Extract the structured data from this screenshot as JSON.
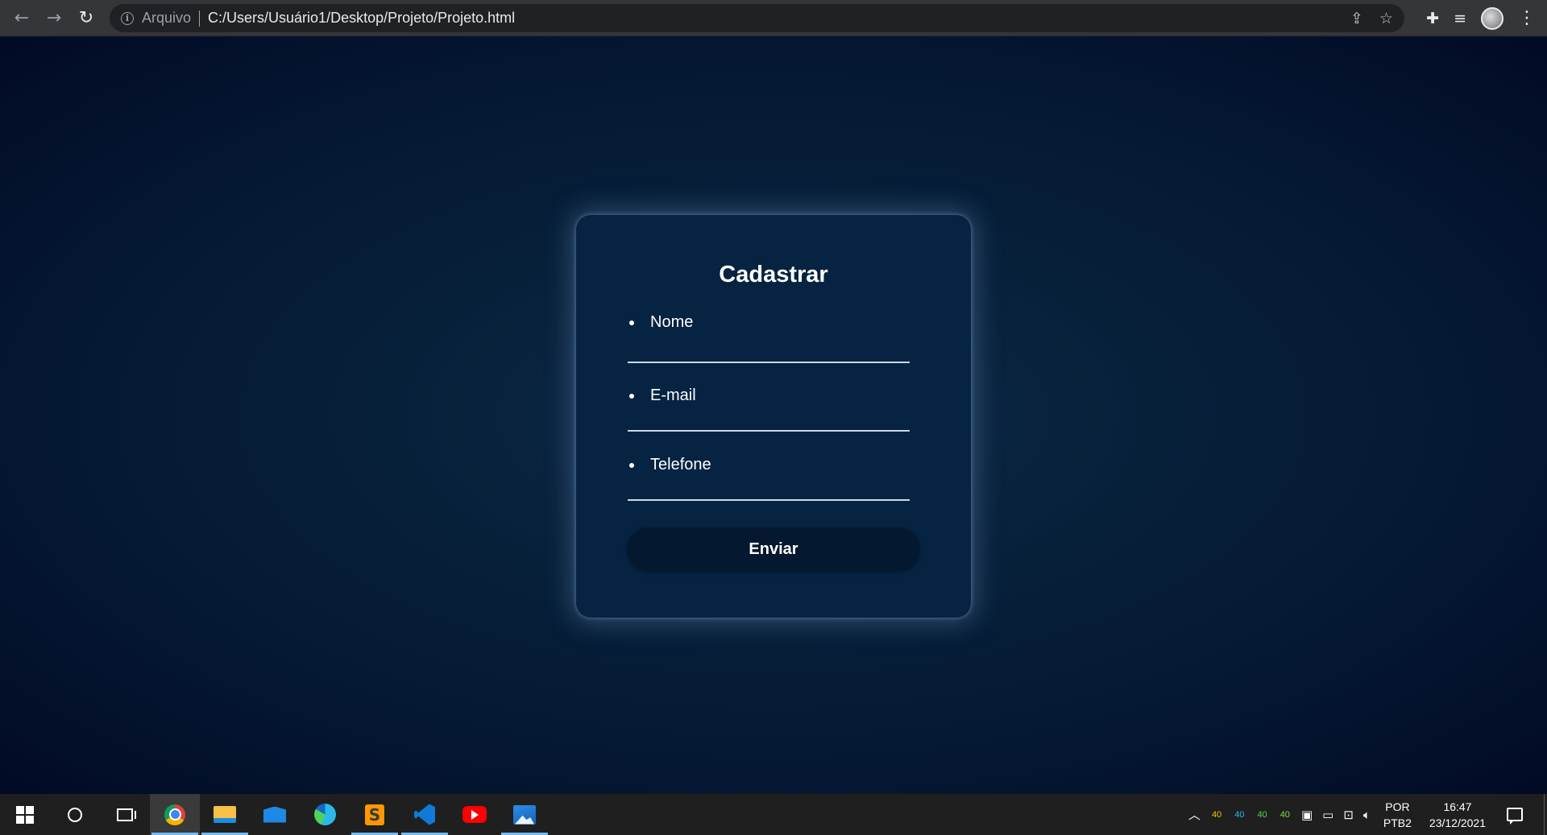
{
  "browser": {
    "scheme_label": "Arquivo",
    "url": "C:/Users/Usuário1/Desktop/Projeto/Projeto.html",
    "icons": [
      "back-icon",
      "forward-icon",
      "reload-icon",
      "info-icon",
      "share-icon",
      "star-icon",
      "extensions-icon",
      "reading-list-icon",
      "profile-avatar",
      "menu-icon"
    ]
  },
  "form": {
    "title": "Cadastrar",
    "fields": [
      {
        "label": "Nome",
        "value": ""
      },
      {
        "label": "E-mail",
        "value": ""
      },
      {
        "label": "Telefone",
        "value": ""
      }
    ],
    "submit_label": "Enviar"
  },
  "taskbar": {
    "apps": [
      "start",
      "cortana-search",
      "task-view",
      "chrome",
      "file-explorer",
      "mail",
      "edge",
      "sublime-text",
      "vscode",
      "youtube",
      "photos"
    ],
    "tray": {
      "meters": [
        {
          "value": "40",
          "color": "#f2c200"
        },
        {
          "value": "40",
          "color": "#2ab8f0"
        },
        {
          "value": "40",
          "color": "#4ed84e"
        },
        {
          "value": "40",
          "color": "#7ee04a"
        }
      ],
      "lang_line1": "POR",
      "lang_line2": "PTB2",
      "time": "16:47",
      "date": "23/12/2021"
    }
  },
  "colors": {
    "background": "#051833",
    "card": "#062342",
    "button": "#04182f",
    "accent_underline": "#76b9ed"
  }
}
